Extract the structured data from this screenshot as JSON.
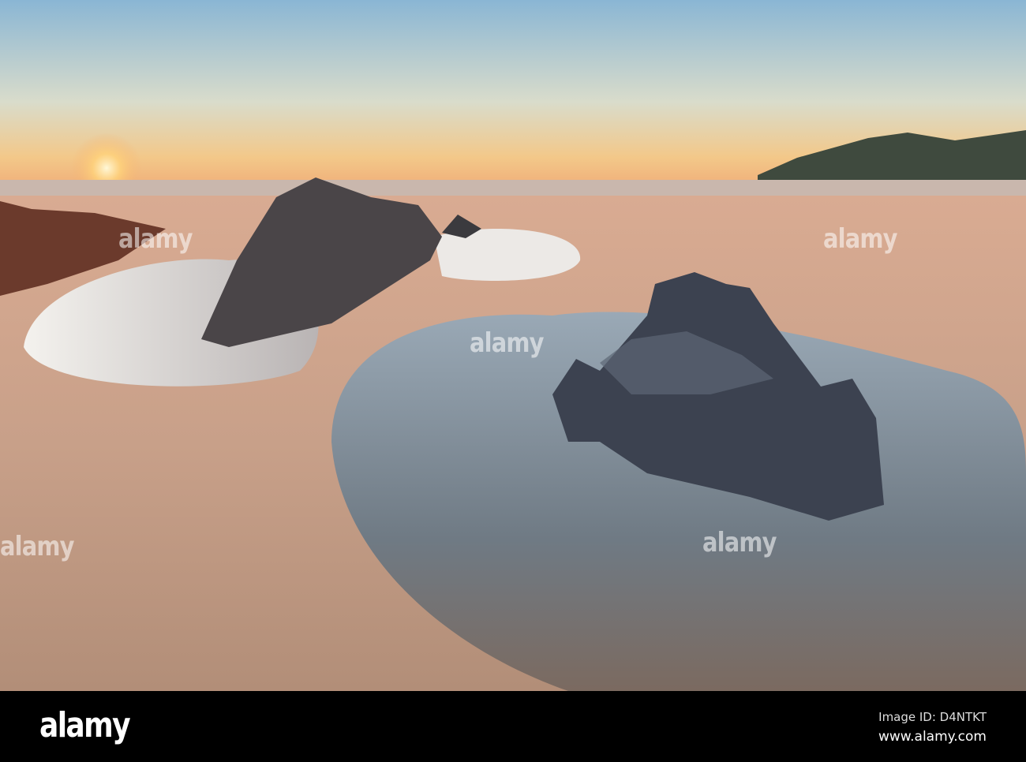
{
  "watermark": "alamy",
  "footer": {
    "logo": "alamy",
    "image_id": "Image ID: D4NTKT",
    "url": "www.alamy.com"
  },
  "colors": {
    "sky_top": "#8fb9d6",
    "horizon": "#f4c27a",
    "sand": "#c9a28c",
    "water": "#7d8a96",
    "rock": "#3a3d46"
  }
}
